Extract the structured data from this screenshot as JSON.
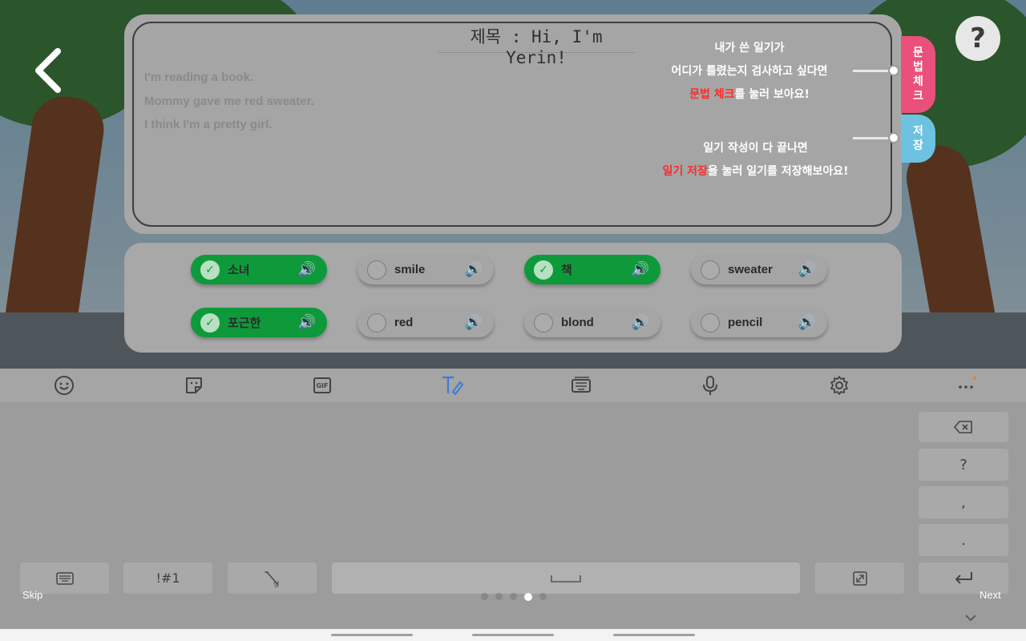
{
  "diary": {
    "title": "제목 : Hi, I'm Yerin!",
    "lines": [
      "I'm reading a book.",
      "Mommy gave me red sweater.",
      "I think I'm a pretty girl."
    ]
  },
  "tabs": {
    "grammar_label": [
      "문",
      "법",
      "체",
      "크"
    ],
    "save_label": [
      "저",
      "장"
    ]
  },
  "tips": {
    "grammar_line1": "내가 쓴 일기가",
    "grammar_line2": "어디가 틀렸는지 검사하고 싶다면",
    "grammar_line3_red": "문법 체크",
    "grammar_line3_rest": "를 눌러 보아요!",
    "save_line1": "일기 작성이 다 끝나면",
    "save_line2_red": "일기 저장",
    "save_line2_rest": "을 눌러 일기를 저장해보아요!"
  },
  "help_label": "?",
  "words": [
    {
      "label": "소녀",
      "checked": true
    },
    {
      "label": "smile",
      "checked": false
    },
    {
      "label": "책",
      "checked": true
    },
    {
      "label": "sweater",
      "checked": false
    },
    {
      "label": "포근한",
      "checked": true
    },
    {
      "label": "red",
      "checked": false
    },
    {
      "label": "blond",
      "checked": false
    },
    {
      "label": "pencil",
      "checked": false
    }
  ],
  "keyboard": {
    "toolbar_icons": [
      "emoji-icon",
      "sticker-icon",
      "gif-icon",
      "handwriting-icon",
      "clipboard-keyboard-icon",
      "microphone-icon",
      "settings-icon",
      "more-icon"
    ],
    "gif_label": "GIF",
    "keys": {
      "backspace": "⌫",
      "question": "?",
      "comma": ",",
      "period": ".",
      "symbols": "!#1",
      "enter": "↵"
    }
  },
  "onboarding": {
    "skip": "Skip",
    "next": "Next",
    "page_count": 5,
    "active_page": 4
  },
  "colors": {
    "chip_checked": "#0e9a3b",
    "grammar_tab": "#e9507a",
    "save_tab": "#6cc2e0",
    "tip_highlight": "#ff2a2a"
  }
}
